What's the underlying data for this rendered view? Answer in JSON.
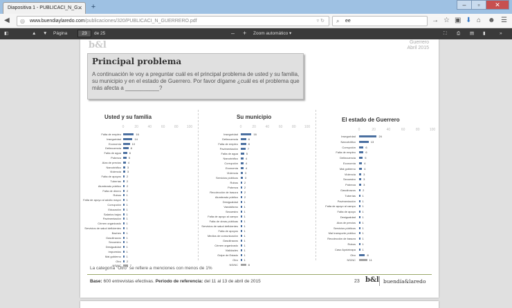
{
  "browser": {
    "tab_title": "Diapositiva 1 - PUBLICACI_N_G...",
    "url_domain": "www.buendiaylaredo.com",
    "url_path": "/publicaciones/320/PUBLICACI_N_GUERRERO.pdf",
    "search_value": "ee"
  },
  "pdf_toolbar": {
    "page_label": "Página",
    "page_value": "23",
    "page_total": "de 25",
    "zoom_label": "Zoom automático"
  },
  "slide": {
    "logo": "b&l",
    "header_state": "Guerrero",
    "header_date": "Abril 2015",
    "title": "Principal problema",
    "question": "A continuación le voy a preguntar cuál es el principal problema de usted y su familia, su municipio y en el estado de Guerrero. Por favor dígame ¿cuál es el problema que más afecta a ___________?",
    "footnote": "La categoría \"Otro\" se refiere a menciones con menos de 1%",
    "footer_base_label": "Base:",
    "footer_base_text": "600 entrevistas efectivas.",
    "footer_period_label": "Periodo de referencia:",
    "footer_period_text": "del 11 al 13 de abril de 2015",
    "footer_page": "23",
    "footer_logo": "b&l",
    "footer_brand": "buendía&laredo"
  },
  "chart_data": [
    {
      "type": "bar",
      "title": "Usted y su familia",
      "xlim": [
        0,
        100
      ],
      "ticks": [
        "0",
        "20",
        "40",
        "60",
        "80",
        "100"
      ],
      "categories": [
        "Falta de empleo",
        "Inseguridad",
        "Economía",
        "Delincuencia",
        "Falta de agua",
        "Pobreza",
        "Alza de precios",
        "Narcotráfico",
        "Violencia",
        "Falta de apoyos",
        "Tuberías",
        "Alumbrado público",
        "Falta de dinero",
        "Robos",
        "Falta de apoyo al adulto mayor",
        "Corrupción",
        "Educación",
        "Salarios bajos",
        "Pavimentación",
        "Crimen organizado",
        "Servicios de salud deficientes",
        "Baches",
        "Gasolinazos",
        "Secuestro",
        "Desigualdad",
        "Impuestos",
        "Mal gobierno",
        "Otro",
        "NS/NC"
      ],
      "values": [
        16,
        14,
        10,
        8,
        6,
        5,
        4,
        3,
        3,
        2,
        2,
        2,
        2,
        1,
        1,
        1,
        1,
        1,
        1,
        1,
        1,
        1,
        1,
        1,
        1,
        1,
        1,
        2,
        7
      ]
    },
    {
      "type": "bar",
      "title": "Su municipio",
      "xlim": [
        0,
        100
      ],
      "ticks": [
        "0",
        "20",
        "40",
        "60",
        "80",
        "100"
      ],
      "categories": [
        "Inseguridad",
        "Delincuencia",
        "Falta de empleo",
        "Pavimentación",
        "Falta de agua",
        "Narcotráfico",
        "Corrupción",
        "Economía",
        "Violencia",
        "Servicios públicos",
        "Robos",
        "Pobreza",
        "Recolección de basura",
        "Alumbrado público",
        "Desigualdad",
        "Vandalismo",
        "Secuestro",
        "Falta de apoyo al campo",
        "Falta de obras públicas",
        "Servicios de salud deficientes",
        "Falta de apoyos",
        "Medios de comunicación",
        "Gasolinazos",
        "Crimen organizado",
        "Vialidades",
        "Golpe de Estado",
        "Otro",
        "NS/NC"
      ],
      "values": [
        16,
        8,
        8,
        7,
        5,
        4,
        4,
        4,
        3,
        3,
        2,
        2,
        2,
        2,
        1,
        1,
        1,
        1,
        1,
        1,
        1,
        1,
        1,
        1,
        1,
        1,
        1,
        8
      ]
    },
    {
      "type": "bar",
      "title": "El estado de Guerrero",
      "xlim": [
        0,
        100
      ],
      "ticks": [
        "0",
        "20",
        "40",
        "60",
        "80",
        "100"
      ],
      "categories": [
        "Inseguridad",
        "Narcotráfico",
        "Corrupción",
        "Falta de empleo",
        "Delincuencia",
        "Economía",
        "Mal gobierno",
        "Violencia",
        "Secuestro",
        "Pobreza",
        "Gasolinazos",
        "Tuberías",
        "Pavimentación",
        "Falta de apoyo al campo",
        "Falta de apoyo",
        "Desigualdad",
        "Alza de precios",
        "Servicios públicos",
        "Mal transporte público",
        "Recolección de basura",
        "Robos",
        "Caso Ayotzinapa",
        "Otro",
        "NS/NC"
      ],
      "values": [
        24,
        13,
        6,
        6,
        5,
        4,
        4,
        3,
        3,
        3,
        2,
        1,
        1,
        1,
        1,
        1,
        1,
        1,
        1,
        1,
        1,
        1,
        8,
        11
      ]
    }
  ]
}
